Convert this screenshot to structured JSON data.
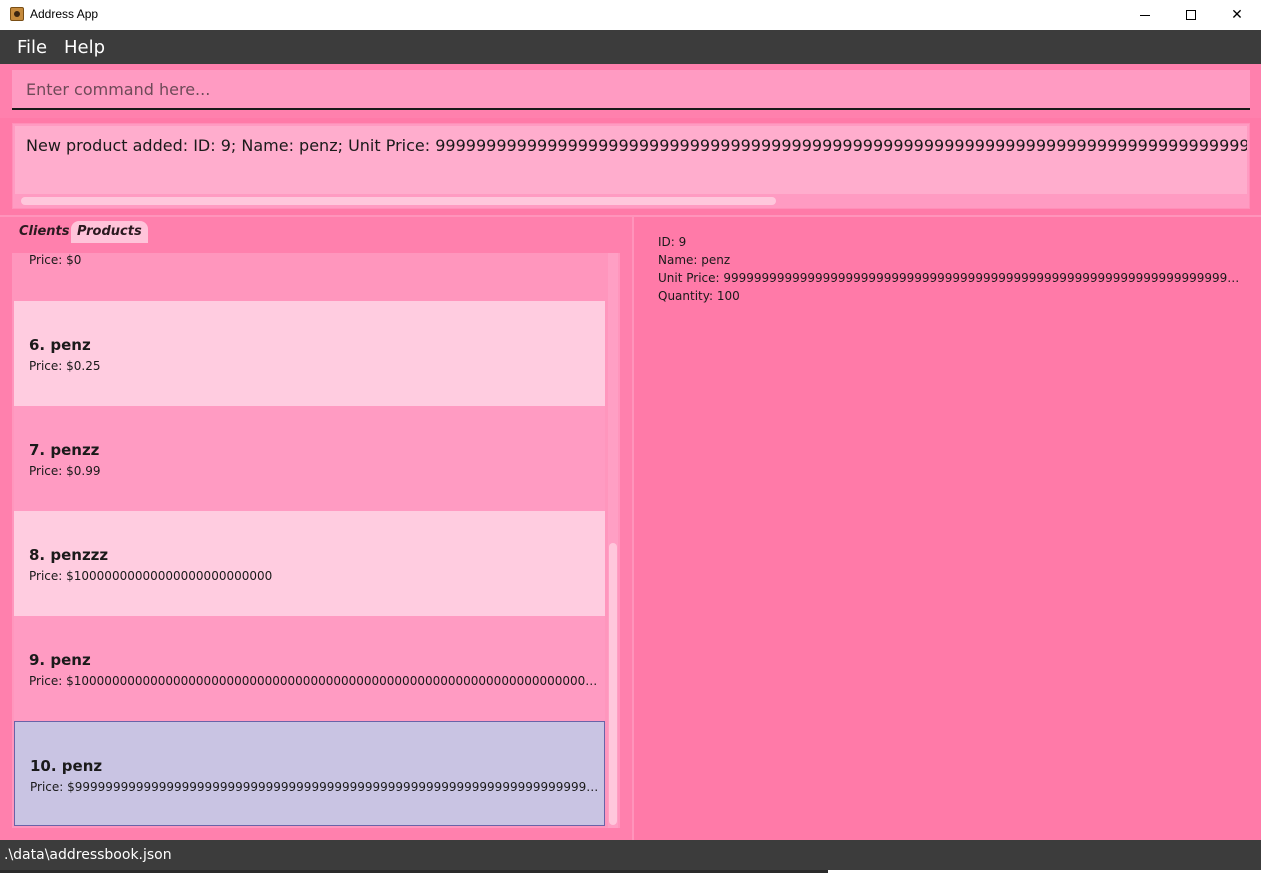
{
  "window": {
    "title": "Address App",
    "minimize_icon": "minimize-icon",
    "maximize_icon": "maximize-icon",
    "close_icon": "close-icon",
    "close_glyph": "✕"
  },
  "menu": {
    "file": "File",
    "help": "Help"
  },
  "command": {
    "placeholder": "Enter command here..."
  },
  "result": {
    "text": "New product added: ID: 9; Name: penz; Unit Price: 9999999999999999999999999999999999999999999999999999999999999999999999999999999999999999999"
  },
  "tabs": {
    "clients": "Clients",
    "products": "Products",
    "active": "Products"
  },
  "products": {
    "partial_price": "Price: $0",
    "items": [
      {
        "title": "6.  penz",
        "price": "Price: $0.25"
      },
      {
        "title": "7.  penzz",
        "price": "Price: $0.99"
      },
      {
        "title": "8.  penzzz",
        "price": "Price: $10000000000000000000000000"
      },
      {
        "title": "9.  penz",
        "price": "Price: $100000000000000000000000000000000000000000000000000000000000000000000000..."
      },
      {
        "title": "10.  penz",
        "price": "Price: $99999999999999999999999999999999999999999999999999999999999999999999999..."
      }
    ],
    "selected_index": 4
  },
  "detail": {
    "id": "ID: 9",
    "name": "Name: penz",
    "unit_price": "Unit Price: 9999999999999999999999999999999999999999999999999999999999999999999999999...",
    "quantity": "Quantity: 100"
  },
  "status": {
    "path": ".\\data\\addressbook.json"
  },
  "colors": {
    "background": "#ff7aa8",
    "menubar": "#3c3c3c",
    "row_light": "#ffcce0",
    "row_mid": "#ff9bc2",
    "row_selected": "#c9c4e3"
  }
}
